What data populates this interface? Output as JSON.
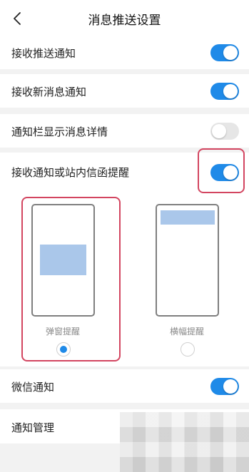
{
  "header": {
    "title": "消息推送设置"
  },
  "settings": {
    "push": {
      "label": "接收推送通知",
      "on": true
    },
    "new_message": {
      "label": "接收新消息通知",
      "on": true
    },
    "show_details": {
      "label": "通知栏显示消息详情",
      "on": false
    },
    "site_mail": {
      "label": "接收通知或站内信函提醒",
      "on": true
    },
    "wechat": {
      "label": "微信通知",
      "on": true
    },
    "manage": {
      "label": "通知管理"
    }
  },
  "reminder_styles": [
    {
      "label": "弹窗提醒",
      "selected": true
    },
    {
      "label": "横幅提醒",
      "selected": false
    }
  ],
  "colors": {
    "accent": "#1f8ae8",
    "highlight": "#d34560",
    "preview_fill": "#aac7ea"
  },
  "icons": [
    "back-chevron-icon"
  ]
}
